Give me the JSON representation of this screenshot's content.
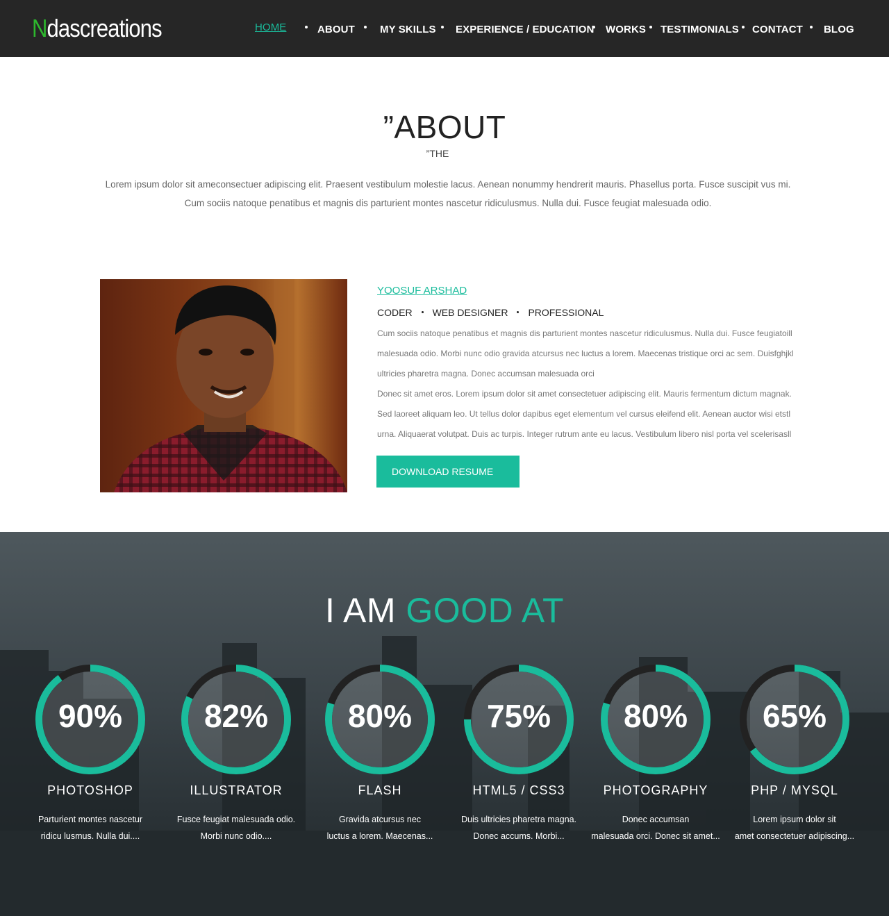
{
  "brand": {
    "first_letter": "N",
    "rest": "dascreations"
  },
  "nav": {
    "items": [
      {
        "label": "HOME",
        "active": true
      },
      {
        "label": "ABOUT"
      },
      {
        "label": "MY SKILLS"
      },
      {
        "label": "EXPERIENCE / EDUCATION"
      },
      {
        "label": "WORKS"
      },
      {
        "label": "TESTIMONIALS"
      },
      {
        "label": "CONTACT"
      },
      {
        "label": "BLOG"
      }
    ]
  },
  "about": {
    "title": "”ABOUT",
    "subtitle": "”THE",
    "intro": "Lorem ipsum dolor sit ameconsectuer adipiscing elit. Praesent vestibulum molestie lacus. Aenean nonummy hendrerit mauris. Phasellus porta. Fusce suscipit vus mi. Cum sociis natoque penatibus et magnis dis parturient montes nascetur ridiculusmus. Nulla dui. Fusce feugiat malesuada odio."
  },
  "profile": {
    "name": "YOOSUF ARSHAD",
    "roles": [
      "CODER",
      "WEB DESIGNER",
      "PROFESSIONAL"
    ],
    "bio": [
      "Cum sociis natoque penatibus et magnis dis parturient montes nascetur ridiculusmus. Nulla dui. Fusce feugiatoill malesuada odio. Morbi nunc odio gravida atcursus nec luctus a lorem. Maecenas tristique orci ac sem. Duisfghjkl ultricies pharetra magna. Donec accumsan malesuada orci",
      "Donec sit amet eros. Lorem ipsum dolor sit amet consectetuer adipiscing elit. Mauris fermentum dictum magnak. Sed laoreet aliquam leo. Ut tellus dolor dapibus eget elementum vel cursus eleifend elit. Aenean auctor wisi etstl urna. Aliquaerat volutpat. Duis ac turpis. Integer rutrum ante eu lacus. Vestibulum libero nisl porta vel scelerisasll"
    ],
    "download_label": "DOWNLOAD RESUME"
  },
  "skills": {
    "title_white": "I AM ",
    "title_accent": "GOOD AT",
    "items": [
      {
        "percent": 90,
        "label": "90%",
        "name": "PHOTOSHOP",
        "desc1": "Parturient montes nascetur",
        "desc2": "ridicu lusmus. Nulla dui...."
      },
      {
        "percent": 82,
        "label": "82%",
        "name": "ILLUSTRATOR",
        "desc1": "Fusce feugiat malesuada odio.",
        "desc2": "Morbi nunc odio...."
      },
      {
        "percent": 80,
        "label": "80%",
        "name": "FLASH",
        "desc1": "Gravida atcursus nec",
        "desc2": "luctus a lorem. Maecenas..."
      },
      {
        "percent": 75,
        "label": "75%",
        "name": "HTML5 / CSS3",
        "desc1": "Duis ultricies pharetra magna.",
        "desc2": "Donec accums. Morbi..."
      },
      {
        "percent": 80,
        "label": "80%",
        "name": "PHOTOGRAPHY",
        "desc1": "Donec accumsan",
        "desc2": "malesuada orci. Donec sit amet..."
      },
      {
        "percent": 65,
        "label": "65%",
        "name": "PHP / MYSQL",
        "desc1": "Lorem ipsum dolor sit",
        "desc2": "amet consectetuer adipiscing..."
      }
    ]
  },
  "colors": {
    "accent": "#1abc9c",
    "nav_bg": "#262626",
    "logo_n": "#2db82d",
    "ring_track": "#222222"
  }
}
